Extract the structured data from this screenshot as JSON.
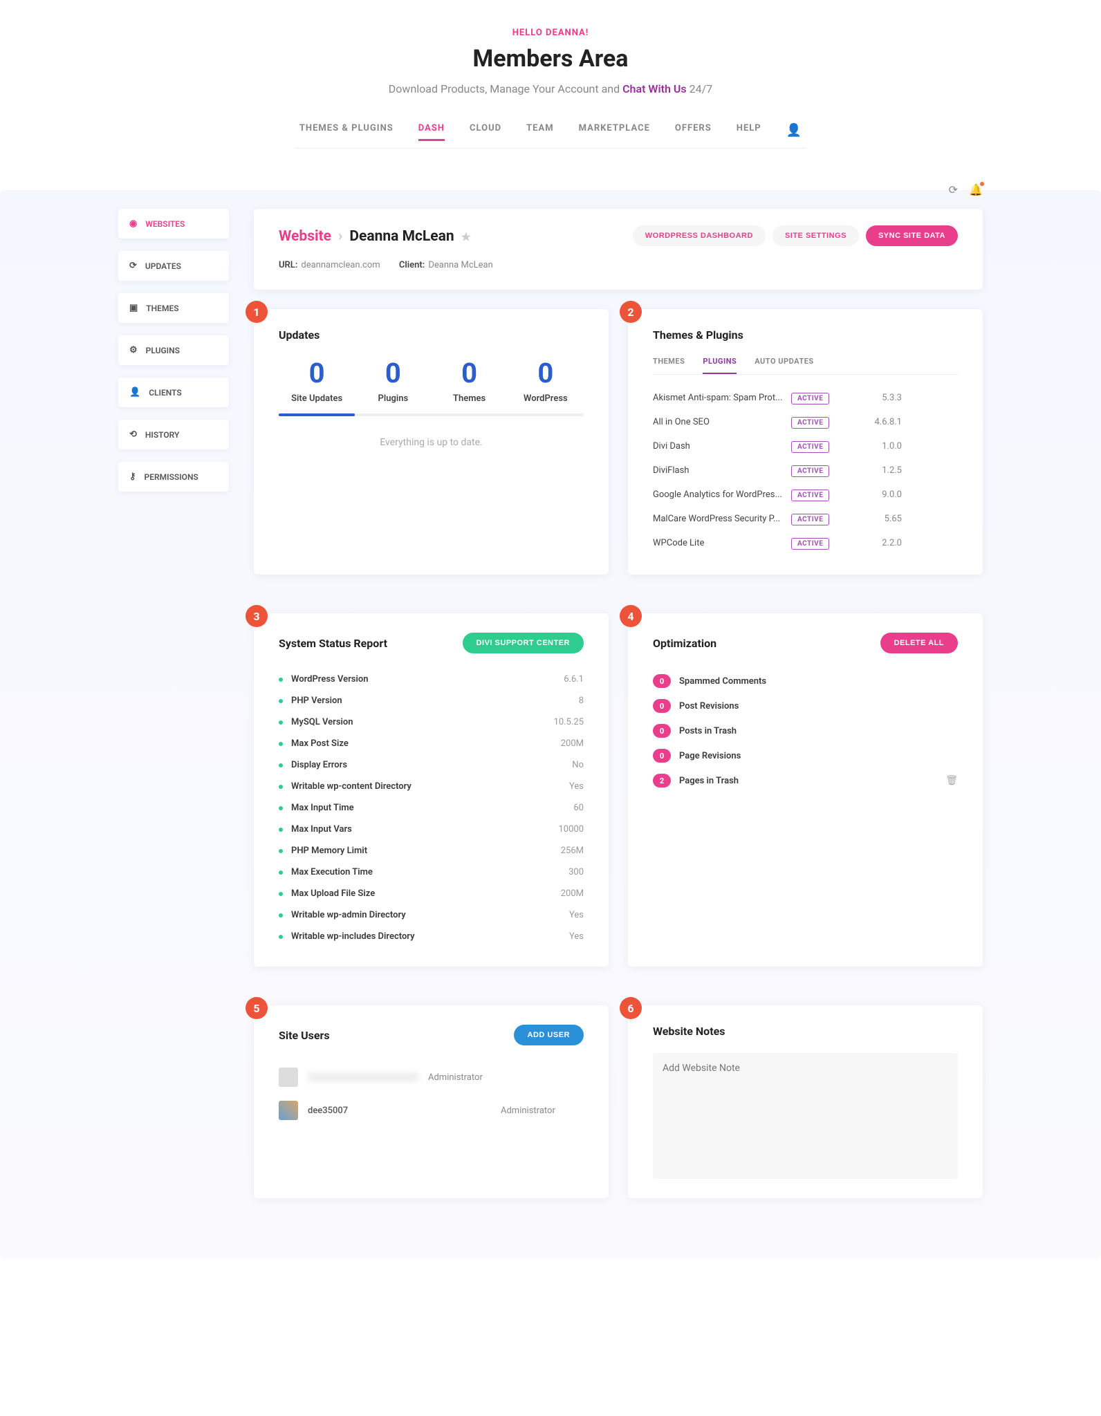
{
  "hello": "HELLO DEANNA!",
  "title": "Members Area",
  "subtitle_pre": "Download Products, Manage Your Account and ",
  "subtitle_chat": "Chat With Us",
  "subtitle_post": " 24/7",
  "topnav": [
    "THEMES & PLUGINS",
    "DASH",
    "CLOUD",
    "TEAM",
    "MARKETPLACE",
    "OFFERS",
    "HELP"
  ],
  "topnav_active": 1,
  "sidenav": [
    {
      "icon": "◉",
      "label": "WEBSITES",
      "active": true
    },
    {
      "icon": "⟳",
      "label": "UPDATES"
    },
    {
      "icon": "▣",
      "label": "THEMES"
    },
    {
      "icon": "⚙",
      "label": "PLUGINS"
    },
    {
      "icon": "👤",
      "label": "CLIENTS"
    },
    {
      "icon": "⟲",
      "label": "HISTORY"
    },
    {
      "icon": "⚷",
      "label": "PERMISSIONS"
    }
  ],
  "header": {
    "breadcrumb_root": "Website",
    "breadcrumb_site": "Deanna McLean",
    "btn_wp": "WORDPRESS DASHBOARD",
    "btn_settings": "SITE SETTINGS",
    "btn_sync": "SYNC SITE DATA",
    "url_label": "URL:",
    "url_value": "deannamclean.com",
    "client_label": "Client:",
    "client_value": "Deanna McLean"
  },
  "updates": {
    "title": "Updates",
    "cols": [
      {
        "num": "0",
        "label": "Site Updates"
      },
      {
        "num": "0",
        "label": "Plugins"
      },
      {
        "num": "0",
        "label": "Themes"
      },
      {
        "num": "0",
        "label": "WordPress"
      }
    ],
    "msg": "Everything is up to date."
  },
  "themes_plugins": {
    "title": "Themes & Plugins",
    "tabs": [
      "THEMES",
      "PLUGINS",
      "AUTO UPDATES"
    ],
    "tabs_active": 1,
    "plugins": [
      {
        "name": "Akismet Anti-spam: Spam Prot...",
        "status": "ACTIVE",
        "ver": "5.3.3"
      },
      {
        "name": "All in One SEO",
        "status": "ACTIVE",
        "ver": "4.6.8.1"
      },
      {
        "name": "Divi Dash",
        "status": "ACTIVE",
        "ver": "1.0.0"
      },
      {
        "name": "DiviFlash",
        "status": "ACTIVE",
        "ver": "1.2.5"
      },
      {
        "name": "Google Analytics for WordPres...",
        "status": "ACTIVE",
        "ver": "9.0.0"
      },
      {
        "name": "MalCare WordPress Security P...",
        "status": "ACTIVE",
        "ver": "5.65"
      },
      {
        "name": "WPCode Lite",
        "status": "ACTIVE",
        "ver": "2.2.0"
      }
    ]
  },
  "system_status": {
    "title": "System Status Report",
    "btn": "DIVI SUPPORT CENTER",
    "rows": [
      {
        "name": "WordPress Version",
        "val": "6.6.1"
      },
      {
        "name": "PHP Version",
        "val": "8"
      },
      {
        "name": "MySQL Version",
        "val": "10.5.25"
      },
      {
        "name": "Max Post Size",
        "val": "200M"
      },
      {
        "name": "Display Errors",
        "val": "No"
      },
      {
        "name": "Writable wp-content Directory",
        "val": "Yes"
      },
      {
        "name": "Max Input Time",
        "val": "60"
      },
      {
        "name": "Max Input Vars",
        "val": "10000"
      },
      {
        "name": "PHP Memory Limit",
        "val": "256M"
      },
      {
        "name": "Max Execution Time",
        "val": "300"
      },
      {
        "name": "Max Upload File Size",
        "val": "200M"
      },
      {
        "name": "Writable wp-admin Directory",
        "val": "Yes"
      },
      {
        "name": "Writable wp-includes Directory",
        "val": "Yes"
      }
    ]
  },
  "optimization": {
    "title": "Optimization",
    "btn": "DELETE ALL",
    "rows": [
      {
        "count": "0",
        "name": "Spammed Comments"
      },
      {
        "count": "0",
        "name": "Post Revisions"
      },
      {
        "count": "0",
        "name": "Posts in Trash"
      },
      {
        "count": "0",
        "name": "Page Revisions"
      },
      {
        "count": "2",
        "name": "Pages in Trash",
        "trash": true
      }
    ]
  },
  "site_users": {
    "title": "Site Users",
    "btn": "ADD USER",
    "users": [
      {
        "name": "",
        "role": "Administrator",
        "blur": true
      },
      {
        "name": "dee35007",
        "role": "Administrator",
        "avatar": true
      }
    ]
  },
  "notes": {
    "title": "Website Notes",
    "placeholder": "Add Website Note"
  },
  "badges": [
    "1",
    "2",
    "3",
    "4",
    "5",
    "6"
  ]
}
